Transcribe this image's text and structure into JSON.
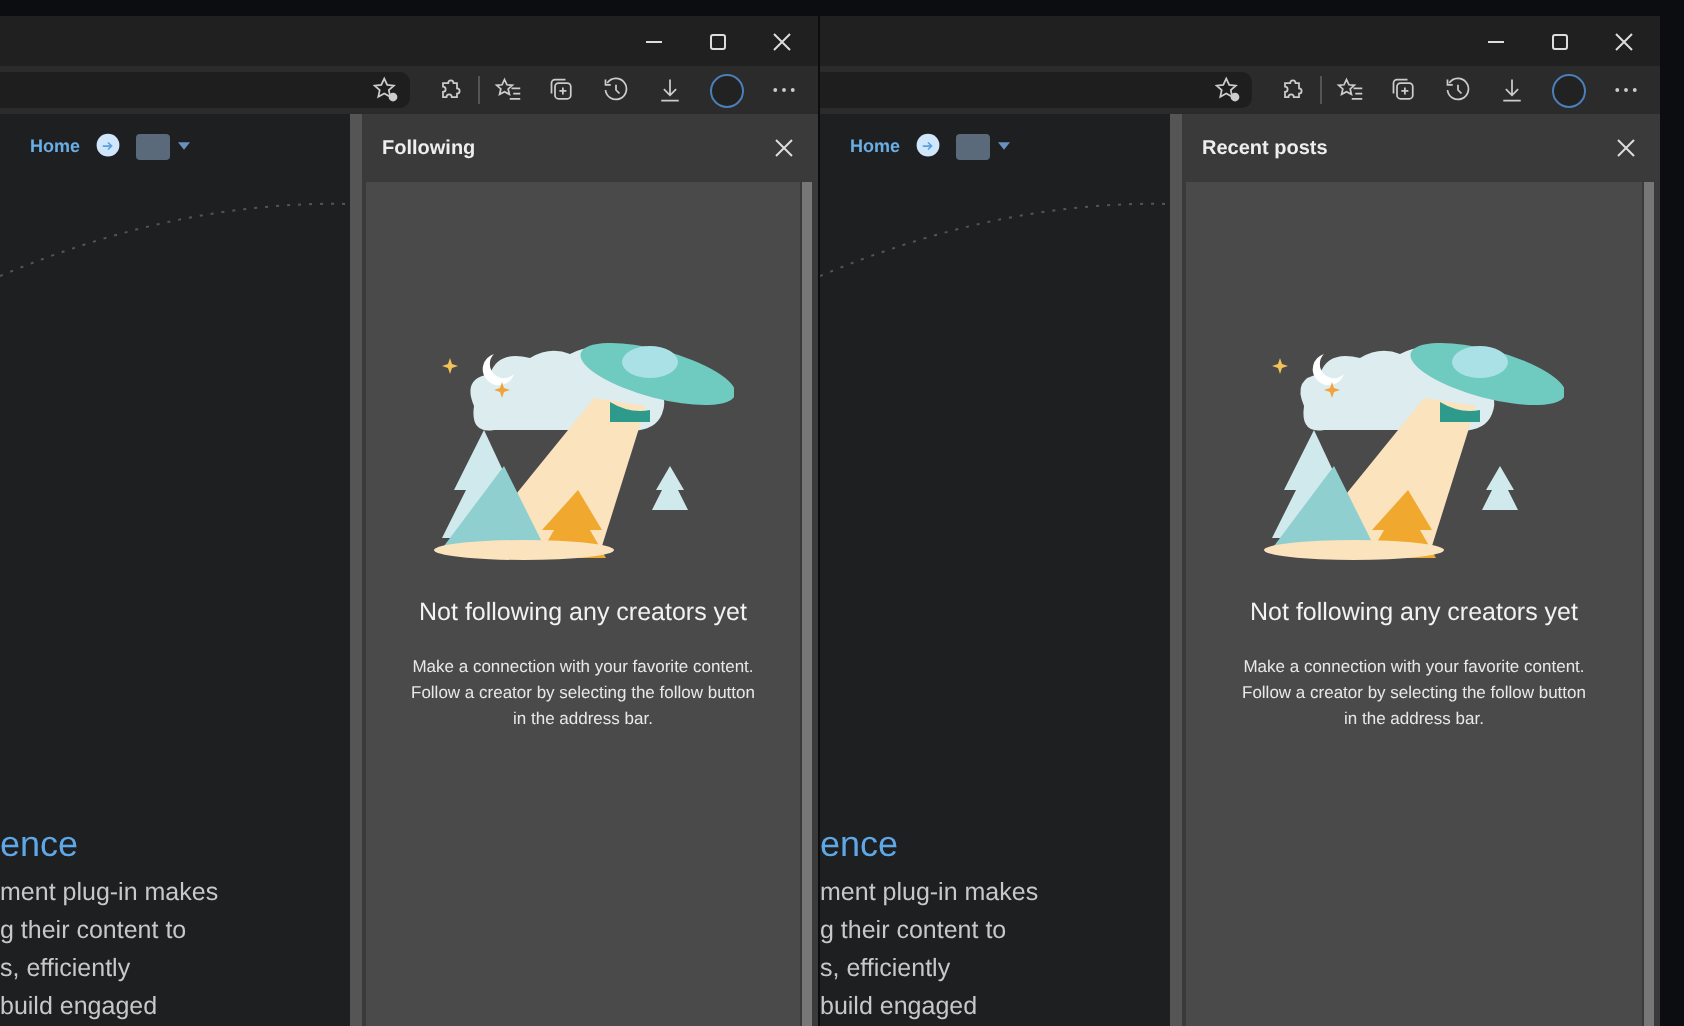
{
  "windows": [
    {
      "page": {
        "nav_link": "Home",
        "heading": "ence",
        "paragraph_lines": [
          "ment plug-in makes",
          "g their content to",
          "s, efficiently",
          "build engaged"
        ]
      },
      "panel": {
        "title": "Following",
        "empty_title": "Not following any creators yet",
        "empty_text_lines": [
          "Make a connection with your favorite content.",
          "Follow a creator by selecting the follow button",
          "in the address bar."
        ]
      }
    },
    {
      "page": {
        "nav_link": "Home",
        "heading": "ence",
        "paragraph_lines": [
          "ment plug-in makes",
          "g their content to",
          "s, efficiently",
          "build engaged"
        ]
      },
      "panel": {
        "title": "Recent posts",
        "empty_title": "Not following any creators yet",
        "empty_text_lines": [
          "Make a connection with your favorite content.",
          "Follow a creator by selecting the follow button",
          "in the address bar."
        ]
      }
    }
  ]
}
